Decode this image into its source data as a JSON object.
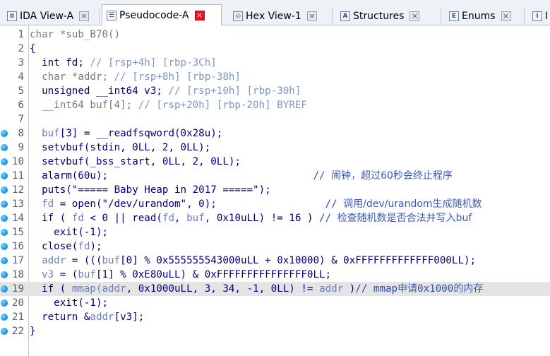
{
  "tabs": [
    {
      "label": "IDA View-A",
      "icon": "ida-view-icon",
      "active": false
    },
    {
      "label": "Pseudocode-A",
      "icon": "pseudocode-icon",
      "active": true
    },
    {
      "label": "Hex View-1",
      "icon": "hex-view-icon",
      "active": false
    },
    {
      "label": "Structures",
      "icon": "structures-icon",
      "active": false
    },
    {
      "label": "Enums",
      "icon": "enums-icon",
      "active": false
    },
    {
      "label": "I",
      "icon": "imports-icon",
      "active": false
    }
  ],
  "close_glyph": "×",
  "highlighted_line": 19,
  "lines": [
    {
      "n": "1",
      "dot": false,
      "segs": [
        [
          "c-ptr",
          "char *sub_B70()"
        ]
      ]
    },
    {
      "n": "2",
      "dot": false,
      "segs": [
        [
          "c-txt",
          "{"
        ]
      ]
    },
    {
      "n": "3",
      "dot": false,
      "segs": [
        [
          "c-txt",
          "  int fd; "
        ],
        [
          "c-cmt",
          "// [rsp+4h] [rbp-3Ch]"
        ]
      ]
    },
    {
      "n": "4",
      "dot": false,
      "segs": [
        [
          "c-ptr",
          "  char *addr; "
        ],
        [
          "c-cmt",
          "// [rsp+8h] [rbp-38h]"
        ]
      ]
    },
    {
      "n": "5",
      "dot": false,
      "segs": [
        [
          "c-txt",
          "  unsigned __int64 v3; "
        ],
        [
          "c-cmt",
          "// [rsp+10h] [rbp-30h]"
        ]
      ]
    },
    {
      "n": "6",
      "dot": false,
      "segs": [
        [
          "c-ptr",
          "  __int64 buf[4]; "
        ],
        [
          "c-cmt",
          "// [rsp+20h] [rbp-20h] BYREF"
        ]
      ]
    },
    {
      "n": "7",
      "dot": false,
      "segs": [
        [
          "c-txt",
          ""
        ]
      ]
    },
    {
      "n": "8",
      "dot": true,
      "segs": [
        [
          "c-var",
          "  buf"
        ],
        [
          "c-txt",
          "[3] = __readfsqword(0x28u);"
        ]
      ]
    },
    {
      "n": "9",
      "dot": true,
      "segs": [
        [
          "c-txt",
          "  setvbuf(stdin, 0LL, 2, 0LL);"
        ]
      ]
    },
    {
      "n": "10",
      "dot": true,
      "segs": [
        [
          "c-txt",
          "  setvbuf(_bss_start, 0LL, 2, 0LL);"
        ]
      ]
    },
    {
      "n": "11",
      "dot": true,
      "segs": [
        [
          "c-txt",
          "  alarm(60u);                                  "
        ],
        [
          "c-cm",
          "// "
        ],
        [
          "c-zh",
          "闹钟，超过60秒会终止程序"
        ]
      ]
    },
    {
      "n": "12",
      "dot": true,
      "segs": [
        [
          "c-txt",
          "  puts(\"===== Baby Heap in 2017 =====\");"
        ]
      ]
    },
    {
      "n": "13",
      "dot": true,
      "segs": [
        [
          "c-var",
          "  fd"
        ],
        [
          "c-txt",
          " = open(\"/dev/urandom\", 0);                  "
        ],
        [
          "c-cm",
          "// "
        ],
        [
          "c-zh",
          "调用/dev/urandom生成随机数"
        ]
      ]
    },
    {
      "n": "14",
      "dot": true,
      "segs": [
        [
          "c-txt",
          "  if ( "
        ],
        [
          "c-var",
          "fd"
        ],
        [
          "c-txt",
          " < 0 || read("
        ],
        [
          "c-var",
          "fd"
        ],
        [
          "c-txt",
          ", "
        ],
        [
          "c-var",
          "buf"
        ],
        [
          "c-txt",
          ", 0x10uLL) != 16 ) "
        ],
        [
          "c-cm",
          "// "
        ],
        [
          "c-zh",
          "检查随机数是否合法并写入buf"
        ]
      ]
    },
    {
      "n": "15",
      "dot": true,
      "segs": [
        [
          "c-txt",
          "    exit(-1);"
        ]
      ]
    },
    {
      "n": "16",
      "dot": true,
      "segs": [
        [
          "c-txt",
          "  close("
        ],
        [
          "c-var",
          "fd"
        ],
        [
          "c-txt",
          ");"
        ]
      ]
    },
    {
      "n": "17",
      "dot": true,
      "segs": [
        [
          "c-var",
          "  addr"
        ],
        [
          "c-txt",
          " = ((("
        ],
        [
          "c-var",
          "buf"
        ],
        [
          "c-txt",
          "[0] % 0x555555543000uLL + 0x10000) & 0xFFFFFFFFFFFFF000LL);"
        ]
      ]
    },
    {
      "n": "18",
      "dot": true,
      "segs": [
        [
          "c-var",
          "  v3"
        ],
        [
          "c-txt",
          " = ("
        ],
        [
          "c-var",
          "buf"
        ],
        [
          "c-txt",
          "[1] % 0xE80uLL) & 0xFFFFFFFFFFFFFFF0LL;"
        ]
      ]
    },
    {
      "n": "19",
      "dot": true,
      "segs": [
        [
          "c-txt",
          "  if ( "
        ],
        [
          "c-var",
          "mmap("
        ],
        [
          "c-var",
          "addr"
        ],
        [
          "c-txt",
          ", 0x1000uLL, 3, 34, -1, 0LL) != "
        ],
        [
          "c-var",
          "addr"
        ],
        [
          "c-txt",
          " )"
        ],
        [
          "c-cm",
          "// mmap"
        ],
        [
          "c-zh",
          "申请"
        ],
        [
          "c-cm",
          "0x1000"
        ],
        [
          "c-zh",
          "的内存"
        ]
      ]
    },
    {
      "n": "20",
      "dot": true,
      "segs": [
        [
          "c-txt",
          "    exit(-1);"
        ]
      ]
    },
    {
      "n": "21",
      "dot": true,
      "segs": [
        [
          "c-txt",
          "  return &"
        ],
        [
          "c-var",
          "addr"
        ],
        [
          "c-txt",
          "[v3];"
        ]
      ]
    },
    {
      "n": "22",
      "dot": true,
      "segs": [
        [
          "c-txt",
          "}"
        ]
      ]
    }
  ]
}
